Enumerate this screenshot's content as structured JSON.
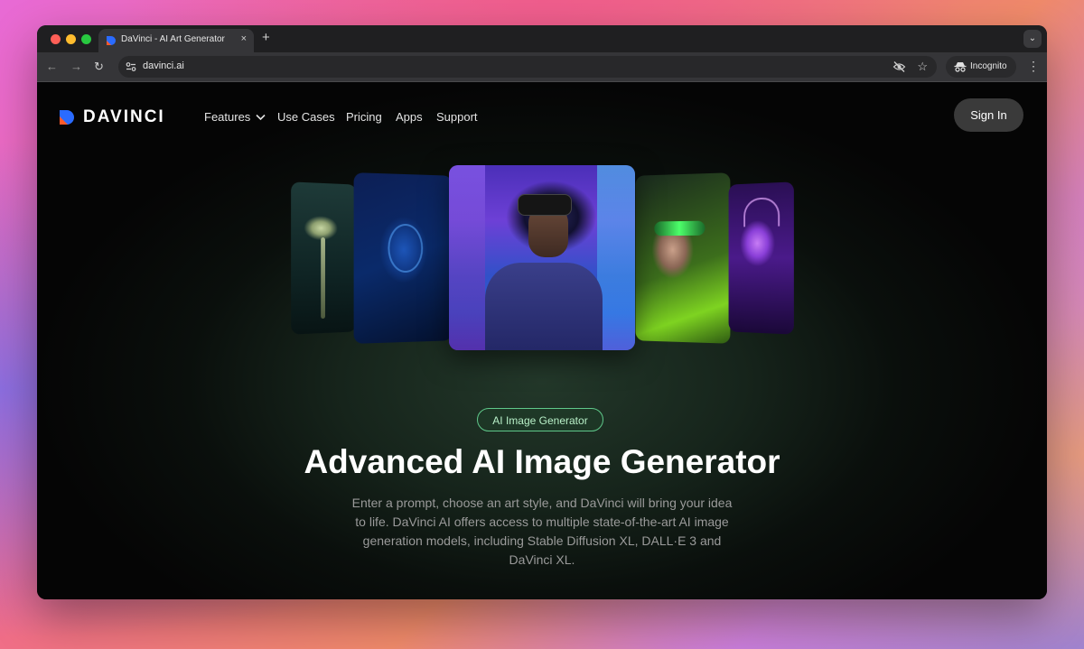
{
  "browser": {
    "tab_title": "DaVinci - AI Art Generator",
    "tab_close": "×",
    "new_tab": "+",
    "tab_search": "⌄",
    "url": "davinci.ai",
    "incognito_label": "Incognito",
    "menu": "⋮",
    "back": "←",
    "forward": "→",
    "reload": "↻",
    "star": "☆"
  },
  "site": {
    "logo_text": "DAVINCI",
    "nav": {
      "features": "Features",
      "use_cases": "Use Cases",
      "pricing": "Pricing",
      "apps": "Apps",
      "support": "Support"
    },
    "sign_in": "Sign In"
  },
  "hero": {
    "badge": "AI Image Generator",
    "title": "Advanced AI Image Generator",
    "description": "Enter a prompt, choose an art style, and DaVinci will bring your idea to life. DaVinci AI offers access to multiple state-of-the-art AI image generation models, including Stable Diffusion XL, DALL·E 3 and DaVinci XL."
  },
  "colors": {
    "accent_green": "#5fc88a",
    "logo_blue": "#2a6bff",
    "logo_orange": "#ff5a2a"
  }
}
